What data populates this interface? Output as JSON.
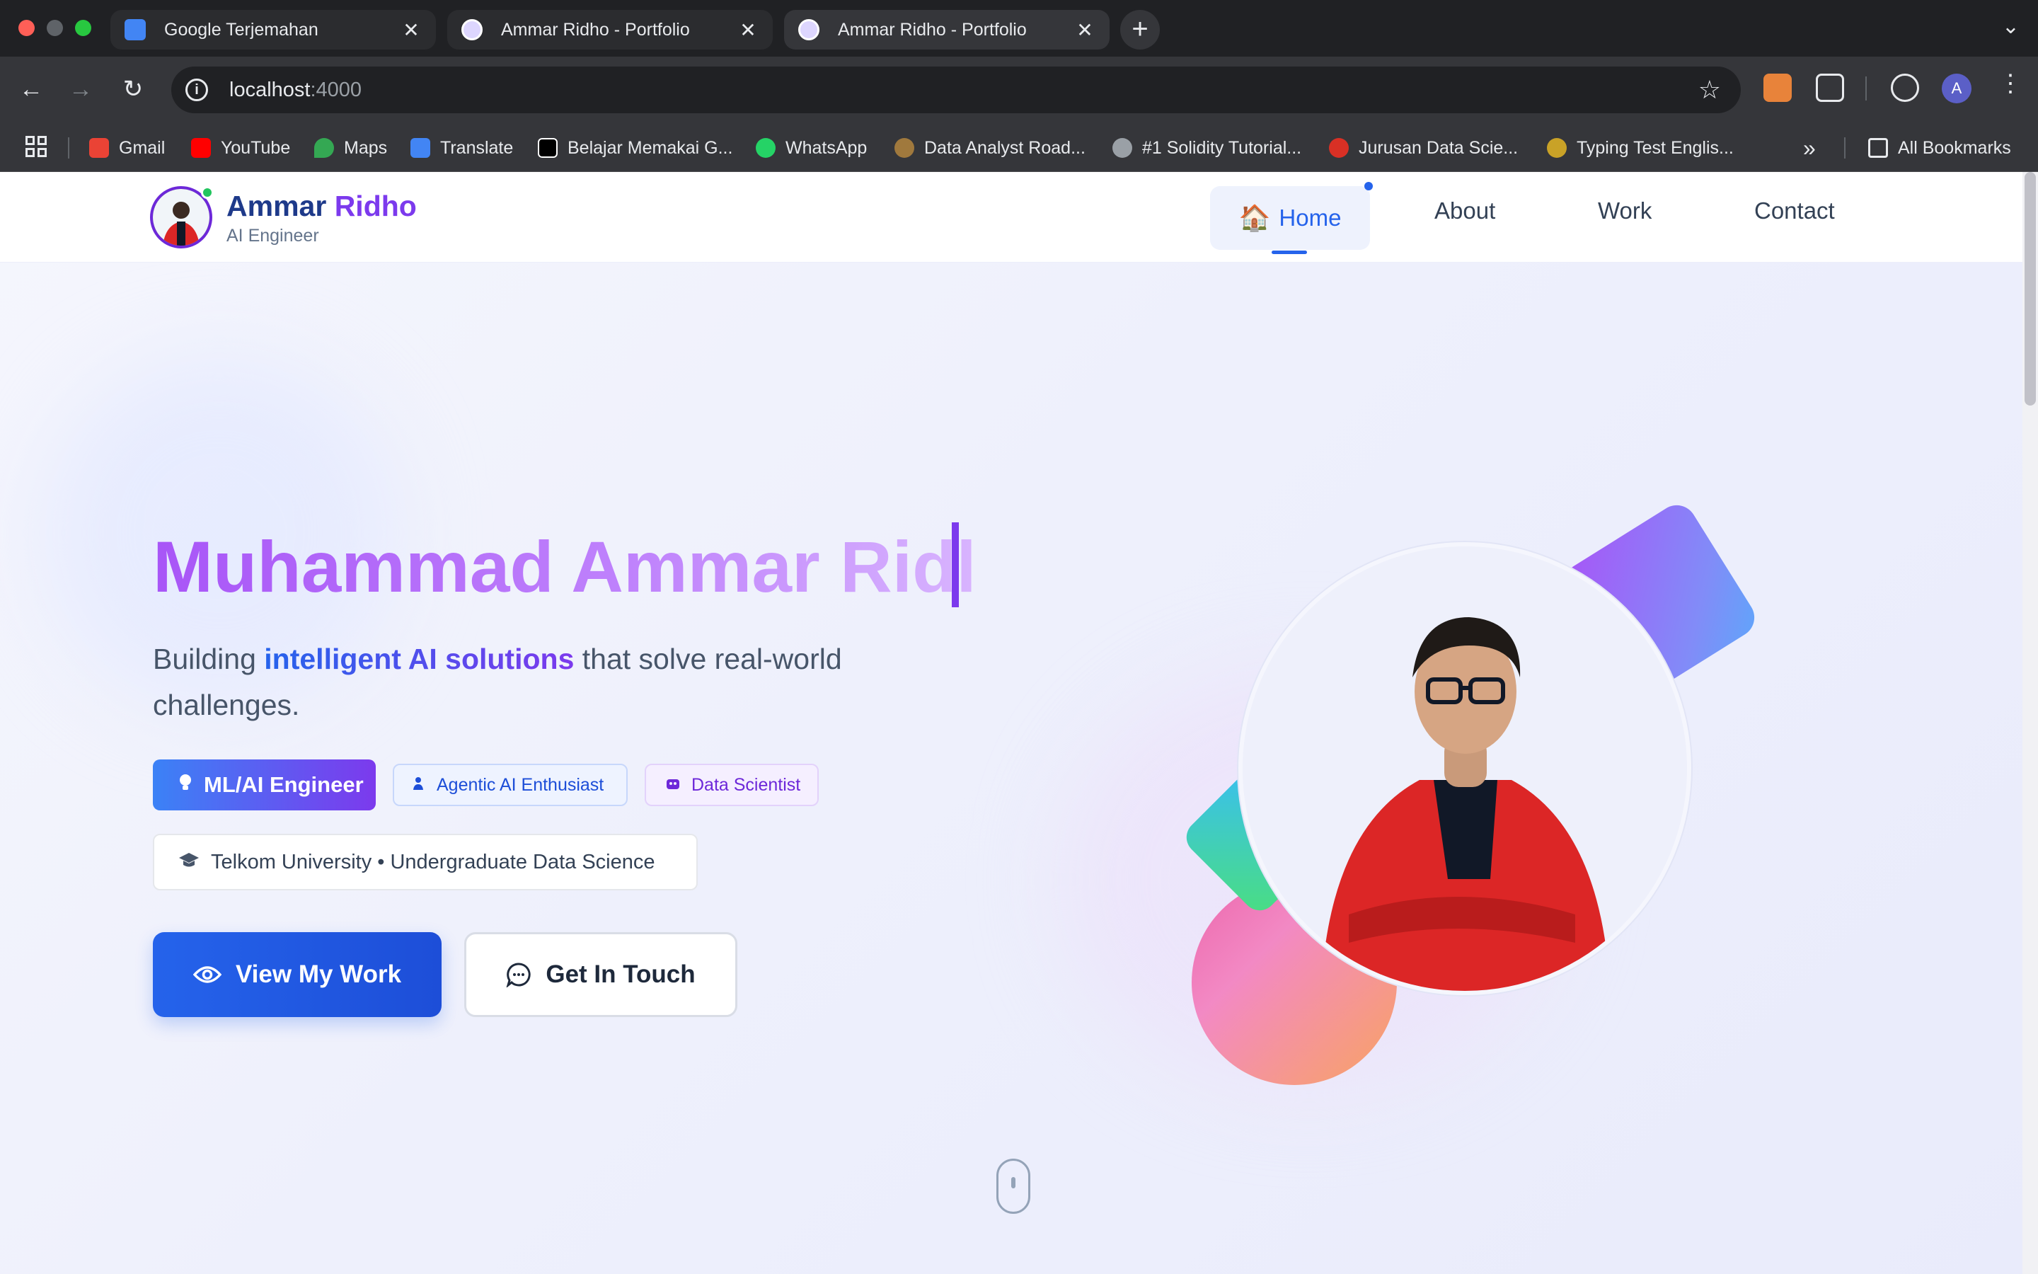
{
  "browser": {
    "tabs": [
      {
        "title": "Google Terjemahan",
        "favicon": "google-translate-icon",
        "active": false
      },
      {
        "title": "Ammar Ridho - Portfolio",
        "favicon": "portfolio-icon",
        "active": false
      },
      {
        "title": "Ammar Ridho - Portfolio",
        "favicon": "portfolio-icon",
        "active": true
      }
    ],
    "new_tab": "+",
    "url_host": "localhost",
    "url_port": ":4000",
    "profile_initial": "A",
    "bookmarks": [
      {
        "label": "Gmail",
        "icon": "gmail-icon"
      },
      {
        "label": "YouTube",
        "icon": "youtube-icon"
      },
      {
        "label": "Maps",
        "icon": "maps-icon"
      },
      {
        "label": "Translate",
        "icon": "translate-icon"
      },
      {
        "label": "Belajar Memakai G...",
        "icon": "medium-icon"
      },
      {
        "label": "WhatsApp",
        "icon": "whatsapp-icon"
      },
      {
        "label": "Data Analyst Road...",
        "icon": "bookmark-icon"
      },
      {
        "label": "#1 Solidity Tutorial...",
        "icon": "bookmark-icon"
      },
      {
        "label": "Jurusan Data Scie...",
        "icon": "bookmark-icon"
      },
      {
        "label": "Typing Test Englis...",
        "icon": "bookmark-icon"
      }
    ],
    "more_bookmarks": "»",
    "all_bookmarks": "All Bookmarks"
  },
  "site": {
    "brand_first": "Ammar",
    "brand_second": "Ridho",
    "brand_sub": "AI Engineer",
    "nav": {
      "home": "Home",
      "about": "About",
      "work": "Work",
      "contact": "Contact"
    },
    "hero": {
      "title": "Muhammad Ammar Ridl",
      "sub_before": "Building ",
      "sub_highlight": "intelligent AI solutions",
      "sub_after": " that solve real-world challenges.",
      "chips": {
        "ml": "ML/AI Engineer",
        "agentic": "Agentic AI Enthusiast",
        "ds": "Data Scientist",
        "uni": "Telkom University • Undergraduate Data Science"
      },
      "btn_work": "View My Work",
      "btn_touch": "Get In Touch"
    }
  },
  "colors": {
    "primary": "#2563eb",
    "accent": "#7c3aed",
    "online": "#22c55e"
  }
}
